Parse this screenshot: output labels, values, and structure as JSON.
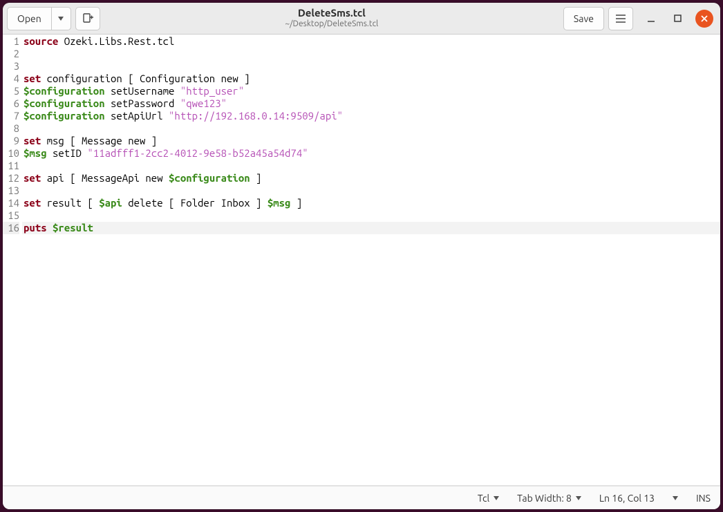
{
  "header": {
    "open_label": "Open",
    "save_label": "Save",
    "title": "DeleteSms.tcl",
    "subtitle": "~/Desktop/DeleteSms.tcl"
  },
  "editor": {
    "line_count": 16,
    "current_line": 16,
    "lines": [
      {
        "tokens": [
          {
            "t": "source",
            "c": "kw"
          },
          {
            "t": " Ozeki.Libs.Rest.tcl"
          }
        ]
      },
      {
        "tokens": []
      },
      {
        "tokens": []
      },
      {
        "tokens": [
          {
            "t": "set",
            "c": "kw"
          },
          {
            "t": " configuration [ Configuration new ]"
          }
        ]
      },
      {
        "tokens": [
          {
            "t": "$configuration",
            "c": "var"
          },
          {
            "t": " setUsername "
          },
          {
            "t": "\"http_user\"",
            "c": "str"
          }
        ]
      },
      {
        "tokens": [
          {
            "t": "$configuration",
            "c": "var"
          },
          {
            "t": " setPassword "
          },
          {
            "t": "\"qwe123\"",
            "c": "str"
          }
        ]
      },
      {
        "tokens": [
          {
            "t": "$configuration",
            "c": "var"
          },
          {
            "t": " setApiUrl "
          },
          {
            "t": "\"http://192.168.0.14:9509/api\"",
            "c": "str"
          }
        ]
      },
      {
        "tokens": []
      },
      {
        "tokens": [
          {
            "t": "set",
            "c": "kw"
          },
          {
            "t": " msg [ Message new ]"
          }
        ]
      },
      {
        "tokens": [
          {
            "t": "$msg",
            "c": "var"
          },
          {
            "t": " setID "
          },
          {
            "t": "\"11adfff1-2cc2-4012-9e58-b52a45a54d74\"",
            "c": "str"
          }
        ]
      },
      {
        "tokens": []
      },
      {
        "tokens": [
          {
            "t": "set",
            "c": "kw"
          },
          {
            "t": " api [ MessageApi new "
          },
          {
            "t": "$configuration",
            "c": "var"
          },
          {
            "t": " ]"
          }
        ]
      },
      {
        "tokens": []
      },
      {
        "tokens": [
          {
            "t": "set",
            "c": "kw"
          },
          {
            "t": " result [ "
          },
          {
            "t": "$api",
            "c": "var"
          },
          {
            "t": " delete [ Folder Inbox ] "
          },
          {
            "t": "$msg",
            "c": "var"
          },
          {
            "t": " ]"
          }
        ]
      },
      {
        "tokens": []
      },
      {
        "tokens": [
          {
            "t": "puts",
            "c": "kw"
          },
          {
            "t": " "
          },
          {
            "t": "$result",
            "c": "var"
          }
        ]
      }
    ]
  },
  "statusbar": {
    "language": "Tcl",
    "tab_width_label": "Tab Width: 8",
    "position": "Ln 16, Col 13",
    "insert_mode": "INS"
  }
}
